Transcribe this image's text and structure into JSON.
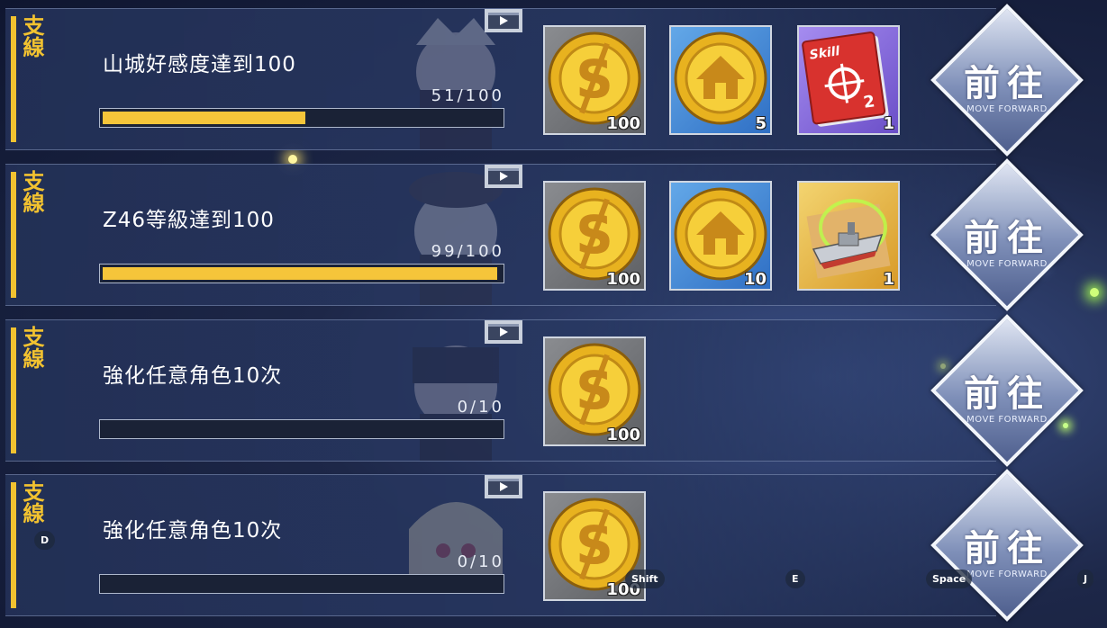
{
  "quests": [
    {
      "tag": "支線",
      "title": "山城好感度達到100",
      "progress_text": "51/100",
      "progress": 0.51,
      "rewards": [
        {
          "icon": "gold-coin-icon",
          "frame": "gray",
          "count": "100"
        },
        {
          "icon": "dorm-coin-icon",
          "frame": "blue",
          "count": "5"
        },
        {
          "icon": "skill-book-icon",
          "frame": "purple",
          "count": "1",
          "book_text": "Skill"
        }
      ],
      "button": {
        "label": "前往",
        "sub": "MOVE FORWARD"
      }
    },
    {
      "tag": "支線",
      "title": "Z46等級達到100",
      "progress_text": "99/100",
      "progress": 0.99,
      "rewards": [
        {
          "icon": "gold-coin-icon",
          "frame": "gray",
          "count": "100"
        },
        {
          "icon": "dorm-coin-icon",
          "frame": "blue",
          "count": "10"
        },
        {
          "icon": "ship-blueprint-icon",
          "frame": "gold",
          "count": "1"
        }
      ],
      "button": {
        "label": "前往",
        "sub": "MOVE FORWARD"
      }
    },
    {
      "tag": "支線",
      "title": "強化任意角色10次",
      "progress_text": "0/10",
      "progress": 0,
      "rewards": [
        {
          "icon": "gold-coin-icon",
          "frame": "gray",
          "count": "100"
        }
      ],
      "button": {
        "label": "前往",
        "sub": "MOVE FORWARD"
      }
    },
    {
      "tag": "支線",
      "title": "強化任意角色10次",
      "progress_text": "0/10",
      "progress": 0,
      "rewards": [
        {
          "icon": "gold-coin-icon",
          "frame": "gray",
          "count": "100"
        }
      ],
      "button": {
        "label": "前往",
        "sub": "MOVE FORWARD"
      }
    }
  ],
  "key_hints": {
    "d": "D",
    "shift": "Shift",
    "e": "E",
    "space": "Space",
    "j": "J"
  },
  "colors": {
    "accent_yellow": "#f2c230",
    "progress_fill": "#f5c53a",
    "panel_bg": "#233056"
  }
}
